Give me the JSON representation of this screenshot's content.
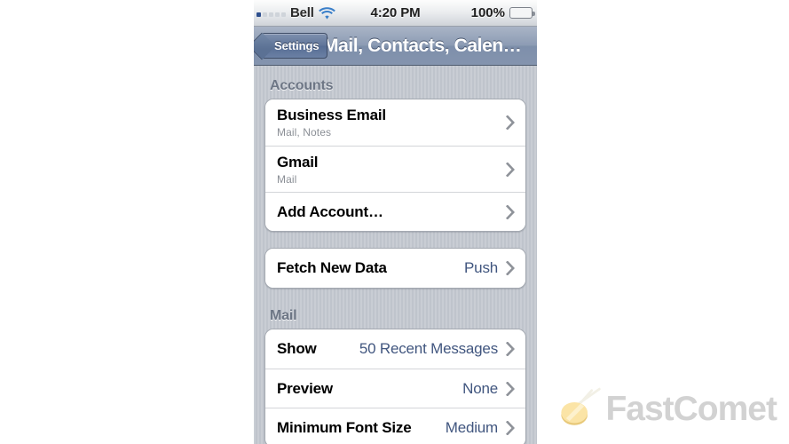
{
  "status_bar": {
    "carrier": "Bell",
    "signal_icon": "signal-dots-icon",
    "signal_bars_filled": 1,
    "signal_bars_total": 5,
    "wifi_icon": "wifi-icon",
    "time": "4:20 PM",
    "battery_percent": "100%",
    "battery_icon": "battery-full-icon",
    "battery_color": "#5fc12a"
  },
  "nav_bar": {
    "back_label": "Settings",
    "back_icon": "back-chevron-icon",
    "title": "Mail, Contacts, Calen…"
  },
  "sections": [
    {
      "header": "Accounts",
      "rows": [
        {
          "title": "Business Email",
          "subtitle": "Mail, Notes",
          "value": "",
          "accessory": "disclosure-chevron-icon"
        },
        {
          "title": "Gmail",
          "subtitle": "Mail",
          "value": "",
          "accessory": "disclosure-chevron-icon"
        },
        {
          "title": "Add Account…",
          "subtitle": "",
          "value": "",
          "accessory": "disclosure-chevron-icon"
        }
      ]
    },
    {
      "header": "",
      "rows": [
        {
          "title": "Fetch New Data",
          "subtitle": "",
          "value": "Push",
          "accessory": "disclosure-chevron-icon"
        }
      ]
    },
    {
      "header": "Mail",
      "rows": [
        {
          "title": "Show",
          "subtitle": "",
          "value": "50 Recent Messages",
          "accessory": "disclosure-chevron-icon"
        },
        {
          "title": "Preview",
          "subtitle": "",
          "value": "None",
          "accessory": "disclosure-chevron-icon"
        },
        {
          "title": "Minimum Font Size",
          "subtitle": "",
          "value": "Medium",
          "accessory": "disclosure-chevron-icon"
        }
      ]
    }
  ],
  "watermark": {
    "brand": "FastComet",
    "icon": "comet-icon",
    "text_color": "#d2d2d2",
    "comet_color": "#f7dd9a"
  },
  "theme": {
    "value_text_color": "#41567f",
    "section_header_color": "#6d7685",
    "nav_bar_color": "#8d9cb4"
  }
}
